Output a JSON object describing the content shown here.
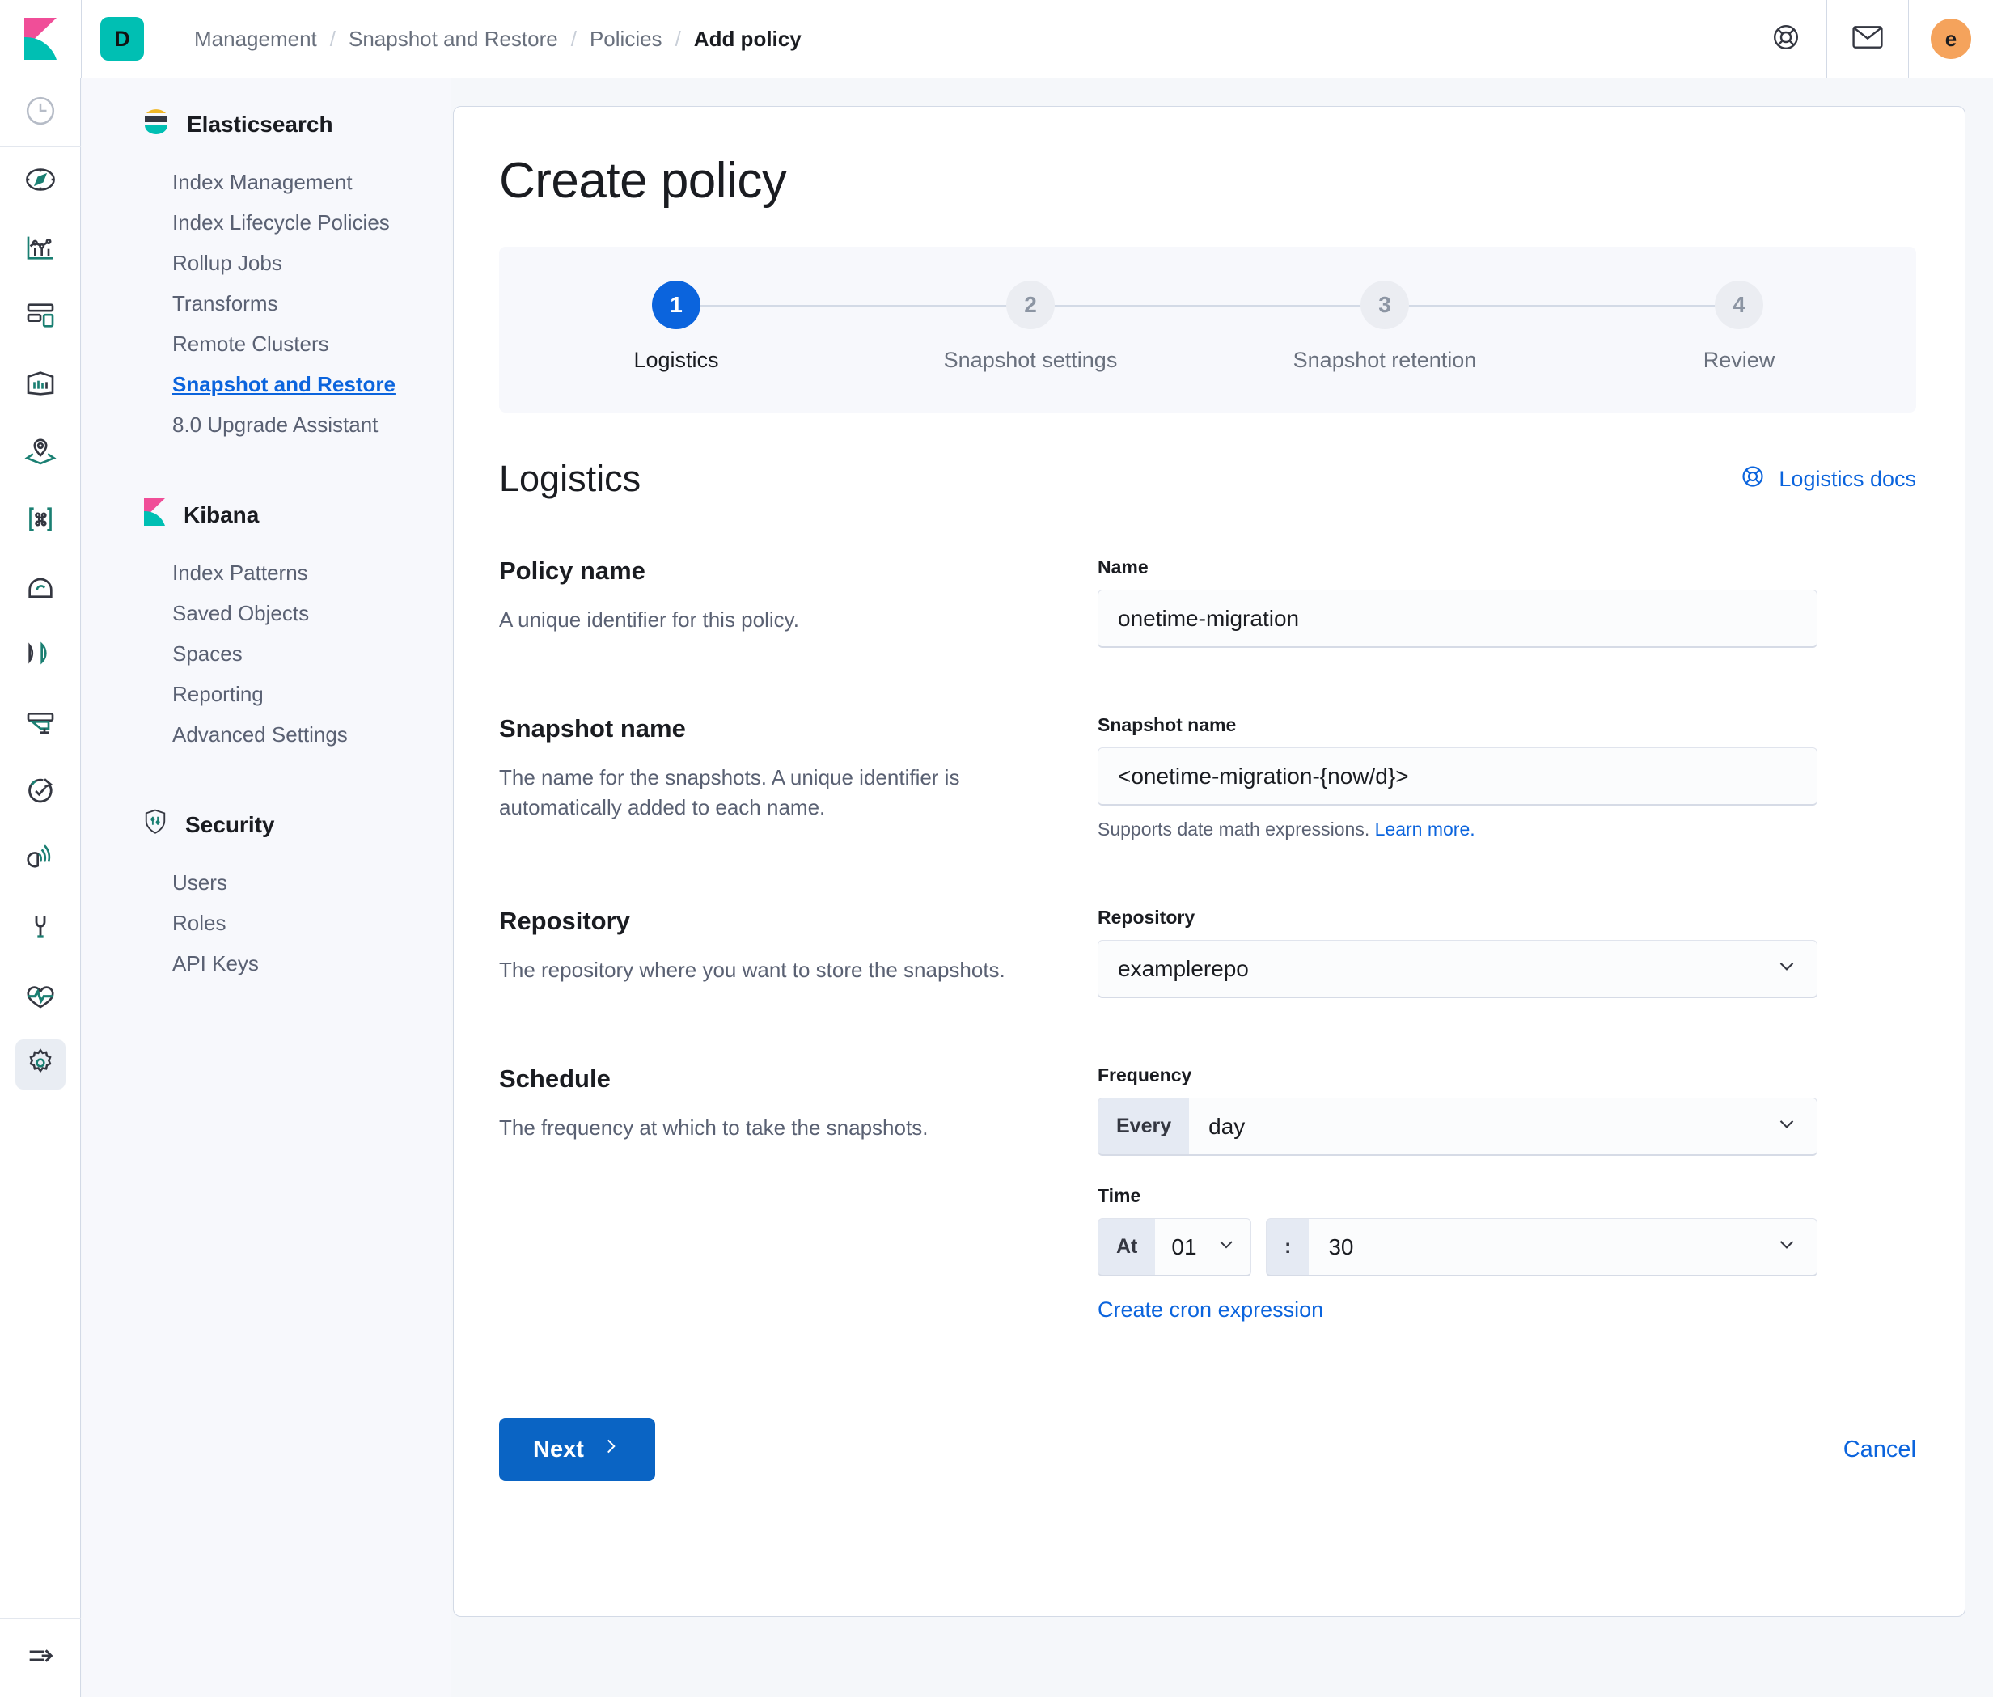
{
  "header": {
    "space_badge": "D",
    "breadcrumbs": [
      {
        "label": "Management",
        "current": false
      },
      {
        "label": "Snapshot and Restore",
        "current": false
      },
      {
        "label": "Policies",
        "current": false
      },
      {
        "label": "Add policy",
        "current": true
      }
    ],
    "separator": "/",
    "help_icon": "lifebuoy-icon",
    "mail_icon": "mail-icon",
    "avatar_initial": "e",
    "avatar_color": "#f5a35c",
    "logo_icon": "kibana-logo-icon"
  },
  "rail": {
    "items": [
      {
        "icon": "recently-viewed-clock-icon"
      },
      {
        "icon": "discover-compass-icon"
      },
      {
        "icon": "visualize-chart-icon"
      },
      {
        "icon": "dashboard-icon"
      },
      {
        "icon": "canvas-icon"
      },
      {
        "icon": "maps-icon"
      },
      {
        "icon": "machine-learning-icon"
      },
      {
        "icon": "infrastructure-icon"
      },
      {
        "icon": "logs-icon"
      },
      {
        "icon": "apm-icon"
      },
      {
        "icon": "uptime-icon"
      },
      {
        "icon": "siem-icon"
      },
      {
        "icon": "dev-tools-wrench-icon"
      },
      {
        "icon": "monitoring-heartbeat-icon"
      },
      {
        "icon": "management-gear-icon"
      }
    ],
    "collapse_icon": "menu-collapse-arrow-icon"
  },
  "sidebar": {
    "groups": [
      {
        "title": "Elasticsearch",
        "icon": "elasticsearch-logo-icon",
        "items": [
          {
            "label": "Index Management",
            "active": false
          },
          {
            "label": "Index Lifecycle Policies",
            "active": false
          },
          {
            "label": "Rollup Jobs",
            "active": false
          },
          {
            "label": "Transforms",
            "active": false
          },
          {
            "label": "Remote Clusters",
            "active": false
          },
          {
            "label": "Snapshot and Restore",
            "active": true
          },
          {
            "label": "8.0 Upgrade Assistant",
            "active": false
          }
        ]
      },
      {
        "title": "Kibana",
        "icon": "kibana-logo-icon",
        "items": [
          {
            "label": "Index Patterns",
            "active": false
          },
          {
            "label": "Saved Objects",
            "active": false
          },
          {
            "label": "Spaces",
            "active": false
          },
          {
            "label": "Reporting",
            "active": false
          },
          {
            "label": "Advanced Settings",
            "active": false
          }
        ]
      },
      {
        "title": "Security",
        "icon": "security-shield-icon",
        "items": [
          {
            "label": "Users",
            "active": false
          },
          {
            "label": "Roles",
            "active": false
          },
          {
            "label": "API Keys",
            "active": false
          }
        ]
      }
    ]
  },
  "main": {
    "page_title": "Create policy",
    "steps": [
      {
        "number": "1",
        "label": "Logistics",
        "active": true
      },
      {
        "number": "2",
        "label": "Snapshot settings",
        "active": false
      },
      {
        "number": "3",
        "label": "Snapshot retention",
        "active": false
      },
      {
        "number": "4",
        "label": "Review",
        "active": false
      }
    ],
    "section_title": "Logistics",
    "docs_link": "Logistics docs",
    "docs_icon": "lifebuoy-icon",
    "sections": {
      "policy_name": {
        "heading": "Policy name",
        "description": "A unique identifier for this policy.",
        "field_label": "Name",
        "field_value": "onetime-migration"
      },
      "snapshot_name": {
        "heading": "Snapshot name",
        "description": "The name for the snapshots. A unique identifier is automatically added to each name.",
        "field_label": "Snapshot name",
        "field_value": "<onetime-migration-{now/d}>",
        "help_text": "Supports date math expressions.",
        "help_link": "Learn more."
      },
      "repository": {
        "heading": "Repository",
        "description": "The repository where you want to store the snapshots.",
        "field_label": "Repository",
        "field_value": "examplerepo"
      },
      "schedule": {
        "heading": "Schedule",
        "description": "The frequency at which to take the snapshots.",
        "frequency_label": "Frequency",
        "frequency_prepend": "Every",
        "frequency_value": "day",
        "time_label": "Time",
        "time_prepend": "At",
        "hour_value": "01",
        "time_separator": ":",
        "minute_value": "30",
        "cron_link": "Create cron expression"
      }
    },
    "footer": {
      "next_label": "Next",
      "next_chevron": "chevron-right-icon",
      "cancel_label": "Cancel"
    }
  },
  "colors": {
    "primary": "#0b64dd",
    "button": "#0a64c4",
    "teal": "#00bfb3",
    "avatar": "#f5a35c"
  }
}
